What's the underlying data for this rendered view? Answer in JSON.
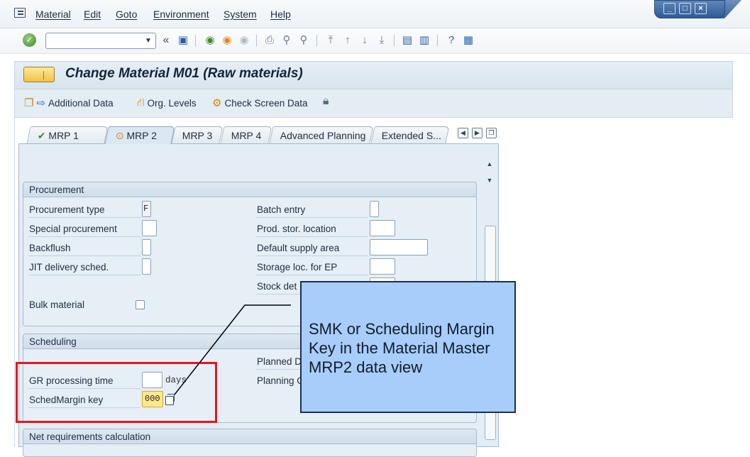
{
  "menubar": {
    "items": [
      "Material",
      "Edit",
      "Goto",
      "Environment",
      "System",
      "Help"
    ]
  },
  "toolbar": {
    "command_field": "",
    "back_symbol": "«"
  },
  "title": {
    "text": "Change Material M01 (Raw materials)"
  },
  "app_toolbar": {
    "additional_data": "Additional Data",
    "org_levels": "Org. Levels",
    "check_screen_data": "Check Screen Data"
  },
  "tabs": [
    {
      "label": "MRP 1"
    },
    {
      "label": "MRP 2"
    },
    {
      "label": "MRP 3"
    },
    {
      "label": "MRP 4"
    },
    {
      "label": "Advanced Planning"
    },
    {
      "label": "Extended S..."
    }
  ],
  "procurement": {
    "title": "Procurement",
    "procurement_type_label": "Procurement type",
    "procurement_type_value": "F",
    "special_procurement_label": "Special procurement",
    "backflush_label": "Backflush",
    "jit_label": "JIT delivery sched.",
    "bulk_material_label": "Bulk material",
    "batch_entry_label": "Batch entry",
    "prod_stor_location_label": "Prod. stor. location",
    "default_supply_area_label": "Default supply area",
    "storage_loc_ep_label": "Storage loc. for EP",
    "stock_det_label": "Stock det"
  },
  "scheduling": {
    "title": "Scheduling",
    "gr_processing_time_label": "GR processing time",
    "gr_unit": "days",
    "sched_margin_key_label": "SchedMargin key",
    "sched_margin_key_value": "000",
    "planned_d_label": "Planned D",
    "planning_c_label": "Planning C"
  },
  "net_requirements": {
    "title": "Net requirements calculation"
  },
  "callout": {
    "text": "SMK or Scheduling Margin Key in the Material Master MRP2 data view",
    "background": "#a8cdfa"
  },
  "colors": {
    "highlight_box": "#e3161e",
    "sched_margin_field": "#ffe98c"
  }
}
